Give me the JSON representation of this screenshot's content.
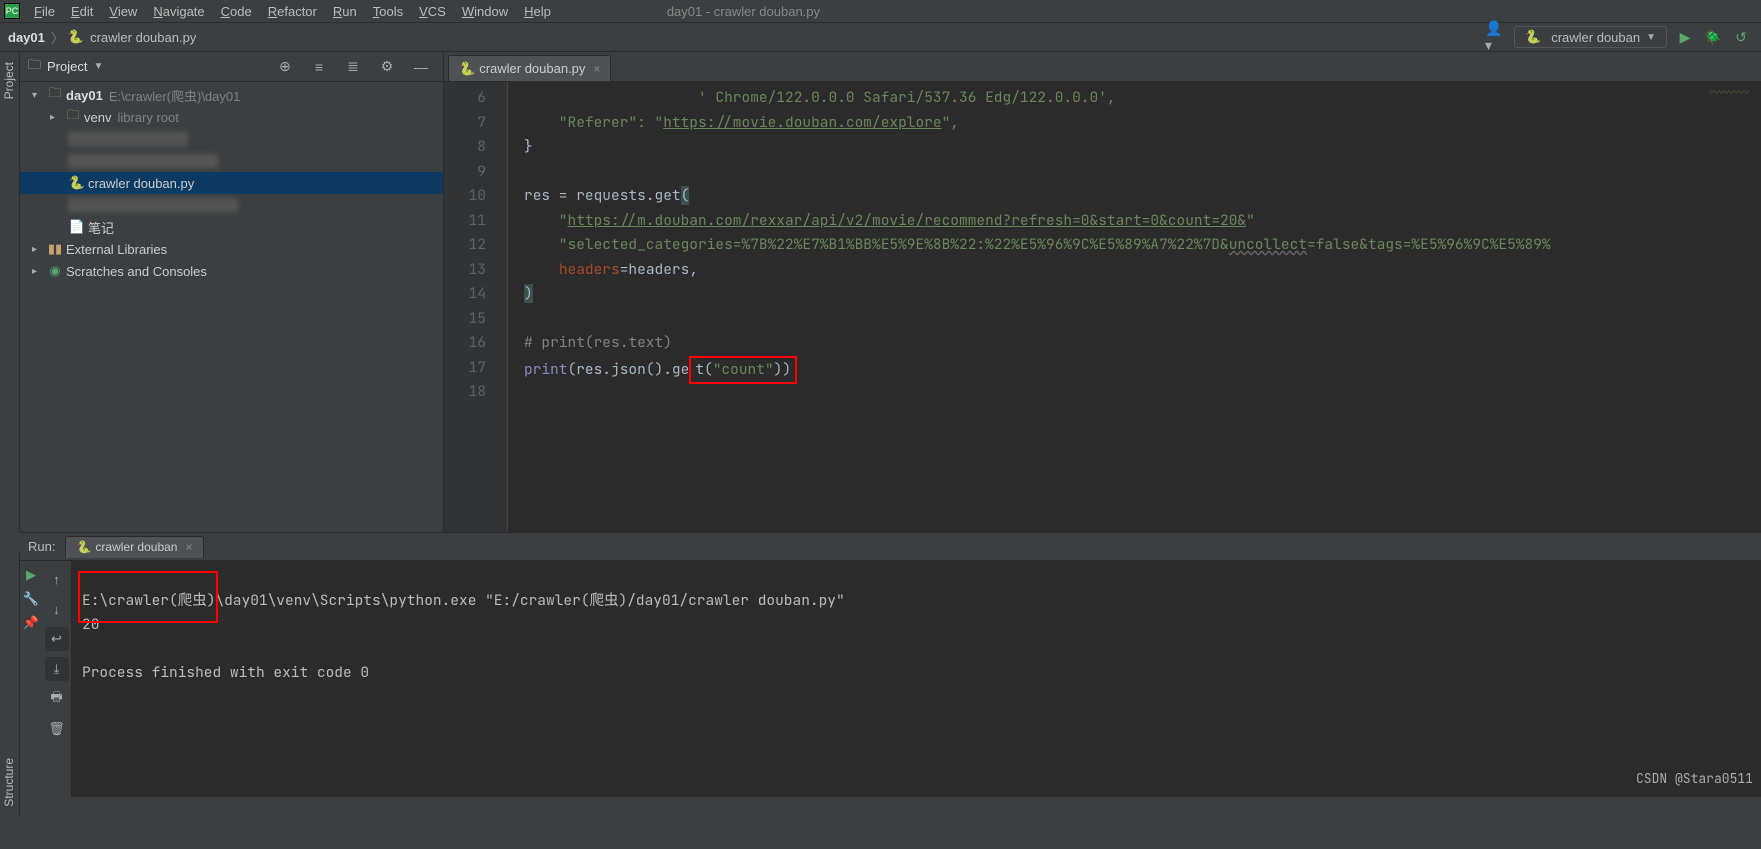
{
  "menu": {
    "items": [
      "File",
      "Edit",
      "View",
      "Navigate",
      "Code",
      "Refactor",
      "Run",
      "Tools",
      "VCS",
      "Window",
      "Help"
    ]
  },
  "window_context": "day01 - crawler douban.py",
  "breadcrumb": {
    "project": "day01",
    "file": "crawler douban.py"
  },
  "run_config": {
    "name": "crawler douban"
  },
  "left_tabs": {
    "top": "Project",
    "bottom": "Structure"
  },
  "project_pane": {
    "title": "Project",
    "root_name": "day01",
    "root_path": "E:\\crawler(爬虫)\\day01",
    "venv": {
      "name": "venv",
      "suffix": "library root"
    },
    "file_selected": "crawler douban.py",
    "notes": "笔记",
    "ext_lib": "External Libraries",
    "scratch": "Scratches and Consoles"
  },
  "editor": {
    "tab_name": "crawler douban.py",
    "first_line_no": 6,
    "lines": {
      "l6": "                    ' Chrome/122.0.0.0 Safari/537.36 Edg/122.0.0.0',",
      "l7a": "    \"Referer\": \"",
      "l7b": "https://movie.douban.com/explore",
      "l7c": "\",",
      "l8": "}",
      "l9": "",
      "l10": "res = requests.get(",
      "l11a": "    \"",
      "l11b": "https://m.douban.com/rexxar/api/v2/movie/recommend?refresh=0&start=0&count=20&",
      "l11c": "\"",
      "l12a": "    \"selected_categories=%7B%22%E7%B1%BB%E5%9E%8B%22:%22%E5%96%9C%E5%89%A7%22%7D&",
      "l12b": "uncollect",
      "l12c": "=false&tags=%E5%96%9C%E5%89%",
      "l13a": "    ",
      "l13b": "headers",
      "l13c": "=headers,",
      "l14": ")",
      "l15": "",
      "l16": "# print(res.text)",
      "l17a": "print",
      "l17b": "(res.json().ge",
      "l17c": "t(",
      "l17d": "\"count\"",
      "l17e": "))",
      "l18": ""
    }
  },
  "run": {
    "label": "Run:",
    "tab": "crawler douban",
    "cmd": "E:\\crawler(爬虫)\\day01\\venv\\Scripts\\python.exe \"E:/crawler(爬虫)/day01/crawler douban.py\"",
    "output": "20",
    "exit": "Process finished with exit code 0"
  },
  "watermark": "CSDN @Stara0511"
}
